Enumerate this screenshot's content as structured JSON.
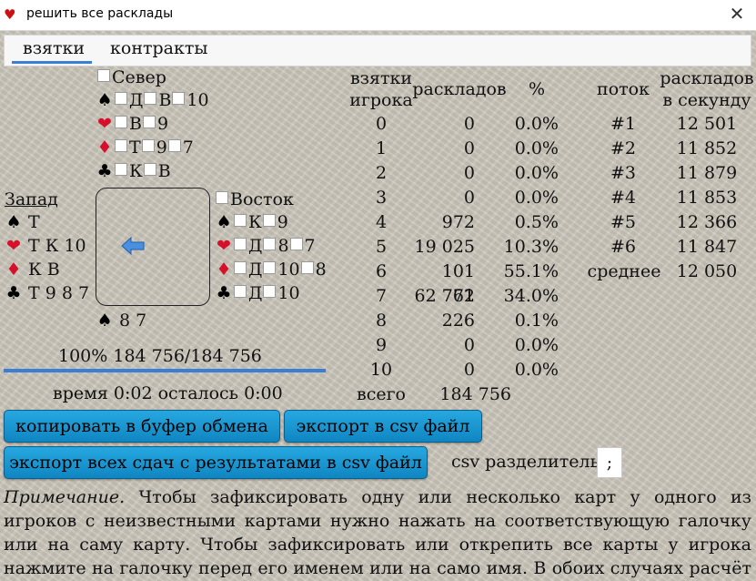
{
  "window": {
    "title": "решить все расклады",
    "close_glyph": "✕"
  },
  "tabs": [
    {
      "label": "взятки",
      "selected": true
    },
    {
      "label": "контракты",
      "selected": false
    }
  ],
  "colors": {
    "accent": "#3a7fd5",
    "button": "#1a97d3",
    "red_suit": "#d6102a"
  },
  "players": {
    "north": {
      "name": "Север",
      "suits": [
        {
          "icon": "spade-icon",
          "color": "black",
          "cards": [
            "Д",
            "В",
            "10"
          ]
        },
        {
          "icon": "heart-icon",
          "color": "red",
          "cards": [
            "В",
            "9"
          ]
        },
        {
          "icon": "diamond-icon",
          "color": "red",
          "cards": [
            "Т",
            "9",
            "7"
          ]
        },
        {
          "icon": "club-icon",
          "color": "black",
          "cards": [
            "К",
            "В"
          ]
        }
      ]
    },
    "west": {
      "name": "Запад",
      "suits": [
        {
          "icon": "spade-icon",
          "color": "black",
          "text": "Т"
        },
        {
          "icon": "heart-icon",
          "color": "red",
          "text": "Т К 10"
        },
        {
          "icon": "diamond-icon",
          "color": "red",
          "text": "К В"
        },
        {
          "icon": "club-icon",
          "color": "black",
          "text": "Т 9 8 7"
        }
      ]
    },
    "east": {
      "name": "Восток",
      "suits": [
        {
          "icon": "spade-icon",
          "color": "black",
          "cards": [
            "К",
            "9"
          ]
        },
        {
          "icon": "heart-icon",
          "color": "red",
          "cards": [
            "Д",
            "8",
            "7"
          ]
        },
        {
          "icon": "diamond-icon",
          "color": "red",
          "cards": [
            "Д",
            "10",
            "8"
          ]
        },
        {
          "icon": "club-icon",
          "color": "black",
          "cards": [
            "Д",
            "10"
          ]
        }
      ]
    },
    "south": {
      "suits": [
        {
          "icon": "spade-icon",
          "color": "black",
          "text": "8 7"
        }
      ]
    }
  },
  "turn_arrow": "arrow-left-icon",
  "progress": {
    "text": "100%   184 756/184 756",
    "fraction": 1.0
  },
  "timer": "время 0:02 осталось 0:00",
  "stats": {
    "headers": {
      "tricks": "взятки игрока",
      "deals": "раскладов",
      "percent": "%"
    },
    "rows": [
      {
        "tricks": "0",
        "deals": "0",
        "percent": "0.0%"
      },
      {
        "tricks": "1",
        "deals": "0",
        "percent": "0.0%"
      },
      {
        "tricks": "2",
        "deals": "0",
        "percent": "0.0%"
      },
      {
        "tricks": "3",
        "deals": "0",
        "percent": "0.0%"
      },
      {
        "tricks": "4",
        "deals": "972",
        "percent": "0.5%"
      },
      {
        "tricks": "5",
        "deals": "19 025",
        "percent": "10.3%"
      },
      {
        "tricks": "6",
        "deals": "101 762",
        "percent": "55.1%"
      },
      {
        "tricks": "7",
        "deals": "62 771",
        "percent": "34.0%"
      },
      {
        "tricks": "8",
        "deals": "226",
        "percent": "0.1%"
      },
      {
        "tricks": "9",
        "deals": "0",
        "percent": "0.0%"
      },
      {
        "tricks": "10",
        "deals": "0",
        "percent": "0.0%"
      }
    ],
    "total_label": "всего",
    "total_value": "184 756"
  },
  "threads": {
    "headers": {
      "thread": "поток",
      "speed": "раскладов в секунду"
    },
    "rows": [
      {
        "thread": "#1",
        "speed": "12 501"
      },
      {
        "thread": "#2",
        "speed": "11 852"
      },
      {
        "thread": "#3",
        "speed": "11 879"
      },
      {
        "thread": "#4",
        "speed": "11 853"
      },
      {
        "thread": "#5",
        "speed": "12 366"
      },
      {
        "thread": "#6",
        "speed": "11 847"
      }
    ],
    "average_label": "среднее",
    "average_value": "12 050"
  },
  "buttons": {
    "copy": "копировать в буфер обмена",
    "export_csv": "экспорт в csv файл",
    "export_all": "экспорт всех сдач с результатами в csv файл"
  },
  "csv": {
    "label": "csv разделитель",
    "value": ";"
  },
  "note": {
    "lead": "Примечание.",
    "text": " Чтобы зафиксировать одну или несколько карт у одного из игроков с неизвестными картами нужно нажать на соответствующую галочку или на саму карту. Чтобы зафиксировать или открепить все карты у игрока нажмите на галочку перед его именем или на само имя. В обоих случаях расчёт начнётся заново."
  }
}
